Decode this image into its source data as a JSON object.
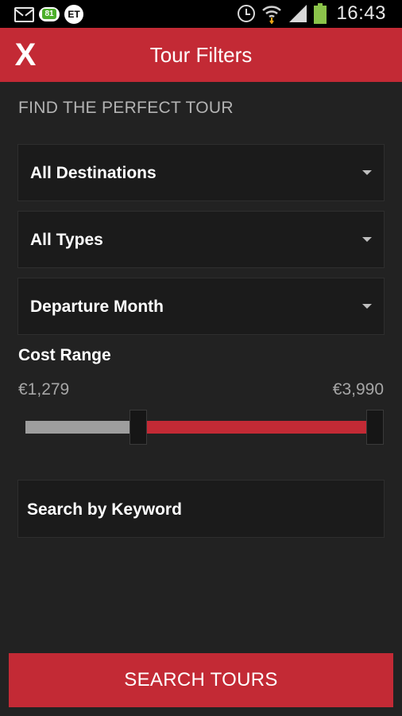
{
  "status_bar": {
    "notification_count": "81",
    "et_badge": "ET",
    "time": "16:43",
    "icons": [
      "gmail-icon",
      "notification-count-icon",
      "et-icon",
      "alarm-icon",
      "wifi-icon",
      "signal-icon",
      "battery-icon"
    ],
    "battery_color": "#8bc34a"
  },
  "header": {
    "close_label": "X",
    "title": "Tour Filters",
    "background": "#c32a35"
  },
  "filters": {
    "section_label": "FIND THE PERFECT TOUR",
    "destination": "All Destinations",
    "type": "All Types",
    "departure_month": "Departure Month"
  },
  "cost": {
    "label": "Cost Range",
    "min_display": "€1,279",
    "max_display": "€3,990",
    "selected_range_color": "#c32a35"
  },
  "keyword": {
    "label": "Search by Keyword"
  },
  "search_button": {
    "label": "SEARCH TOURS"
  }
}
